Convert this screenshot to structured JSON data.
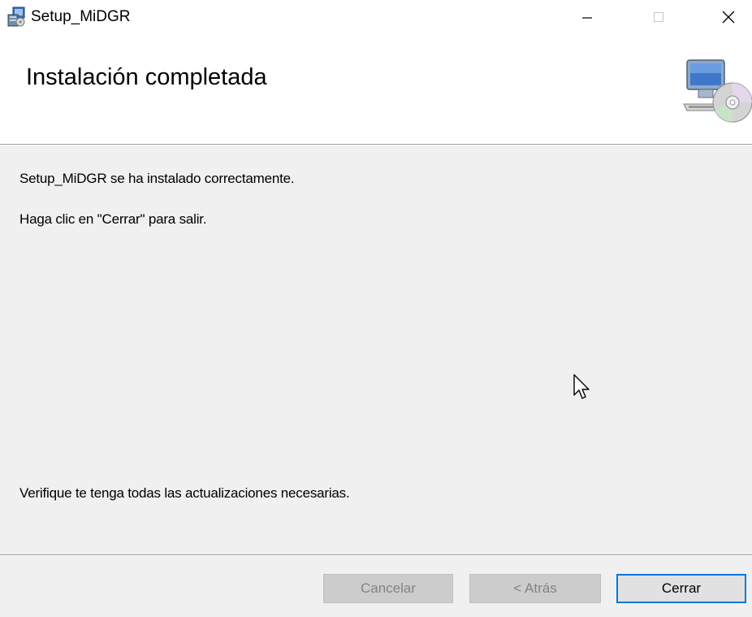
{
  "window": {
    "title": "Setup_MiDGR",
    "controls": {
      "minimize_icon": "minimize-icon",
      "maximize_icon": "maximize-icon",
      "close_icon": "close-icon"
    }
  },
  "header": {
    "title": "Instalación completada",
    "icon": "computer-cd-icon"
  },
  "body": {
    "line1": "Setup_MiDGR se ha instalado correctamente.",
    "line2": "Haga clic en \"Cerrar\" para salir.",
    "line3": "Verifique te tenga todas las actualizaciones necesarias."
  },
  "footer": {
    "cancel_label": "Cancelar",
    "back_label": "< Atrás",
    "close_label": "Cerrar"
  },
  "colors": {
    "accent": "#0078d7",
    "dialog_bg": "#f0f0f0",
    "disabled_button_bg": "#cccccc",
    "disabled_text": "#838383"
  }
}
